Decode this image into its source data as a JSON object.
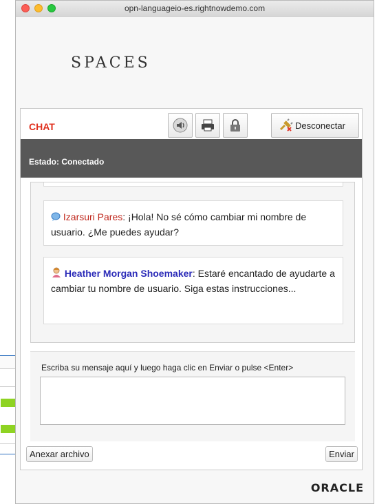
{
  "browser": {
    "url": "opn-languageio-es.rightnowdemo.com"
  },
  "site": {
    "logo": "SPACES"
  },
  "chat": {
    "title": "CHAT",
    "disconnect_label": "Desconectar",
    "status": "Estado: Conectado",
    "messages": [
      {
        "author": "Izarsuri Pares",
        "author_role": "user",
        "text": ": ¡Hola! No sé cómo cambiar mi nombre de usuario. ¿Me puedes ayudar?"
      },
      {
        "author": "Heather Morgan Shoemaker",
        "author_role": "agent",
        "text": ": Estaré encantado de ayudarte a cambiar tu nombre de usuario. Siga estas instrucciones..."
      }
    ],
    "input_prompt": "Escriba su mensaje aquí y luego haga clic en Enviar o pulse <Enter>",
    "attach_label": "Anexar archivo",
    "send_label": "Enviar"
  },
  "branding": {
    "footer_logo": "ORACLE"
  },
  "colors": {
    "status_bg": "#585858",
    "chat_title": "#e0301e",
    "agent_name": "#2b2bb8",
    "user_name": "#c0281d"
  },
  "icons": [
    "sound-icon",
    "print-icon",
    "secure-lock-icon",
    "disconnect-plug-icon",
    "user-chat-icon",
    "agent-avatar-icon"
  ]
}
